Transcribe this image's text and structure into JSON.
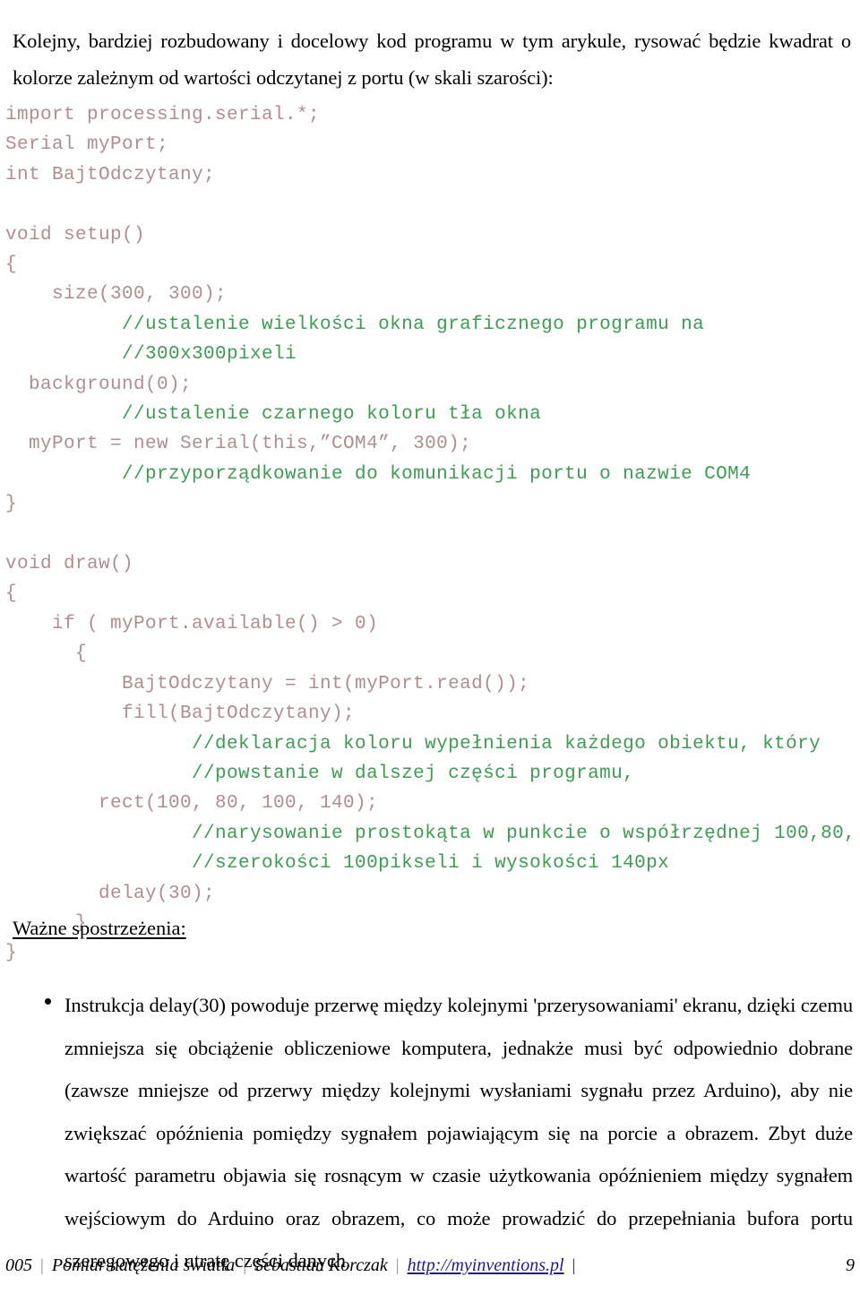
{
  "intro": {
    "paragraph": "Kolejny, bardziej rozbudowany i docelowy kod programu w tym arykule, rysować będzie kwadrat o kolorze zależnym od wartości odczytanej z portu (w skali szarości):"
  },
  "code": {
    "language": "processing",
    "colors": {
      "code": "#b08d90",
      "comment": "#3f9c52"
    },
    "lines": [
      {
        "indent": 0,
        "text": "import processing.serial.*;",
        "kind": "code"
      },
      {
        "indent": 0,
        "text": "Serial myPort;",
        "kind": "code"
      },
      {
        "indent": 0,
        "text": "int BajtOdczytany;",
        "kind": "code"
      },
      {
        "indent": 0,
        "text": "",
        "kind": "blank"
      },
      {
        "indent": 0,
        "text": "void setup()",
        "kind": "code"
      },
      {
        "indent": 0,
        "text": "{",
        "kind": "code"
      },
      {
        "indent": 2,
        "text": "size(300, 300);",
        "kind": "code"
      },
      {
        "indent": 5,
        "text": "//ustalenie wielkości okna graficznego programu na",
        "kind": "comment"
      },
      {
        "indent": 5,
        "text": "//300x300pixeli",
        "kind": "comment"
      },
      {
        "indent": 1,
        "text": "background(0);",
        "kind": "code"
      },
      {
        "indent": 5,
        "text": "//ustalenie czarnego koloru tła okna",
        "kind": "comment"
      },
      {
        "indent": 1,
        "text": "myPort = new Serial(this,”COM4”, 300);",
        "kind": "code"
      },
      {
        "indent": 5,
        "text": "//przyporządkowanie do komunikacji portu o nazwie COM4",
        "kind": "comment"
      },
      {
        "indent": 0,
        "text": "}",
        "kind": "code"
      },
      {
        "indent": 0,
        "text": "",
        "kind": "blank"
      },
      {
        "indent": 0,
        "text": "void draw()",
        "kind": "code"
      },
      {
        "indent": 0,
        "text": "{",
        "kind": "code"
      },
      {
        "indent": 2,
        "text": "if ( myPort.available() > 0)",
        "kind": "code"
      },
      {
        "indent": 3,
        "text": "{",
        "kind": "code"
      },
      {
        "indent": 5,
        "text": "BajtOdczytany = int(myPort.read());",
        "kind": "code"
      },
      {
        "indent": 5,
        "text": "fill(BajtOdczytany);",
        "kind": "code"
      },
      {
        "indent": 8,
        "text": "//deklaracja koloru wypełnienia każdego obiektu, który",
        "kind": "comment"
      },
      {
        "indent": 8,
        "text": "//powstanie w dalszej części programu,",
        "kind": "comment"
      },
      {
        "indent": 4,
        "text": "rect(100, 80, 100, 140);",
        "kind": "code"
      },
      {
        "indent": 8,
        "text": "//narysowanie prostokąta w punkcie o współrzędnej 100,80,",
        "kind": "comment"
      },
      {
        "indent": 8,
        "text": "//szerokości 100pikseli i wysokości 140px",
        "kind": "comment"
      },
      {
        "indent": 4,
        "text": "delay(30);",
        "kind": "code"
      },
      {
        "indent": 3,
        "text": "}",
        "kind": "code"
      },
      {
        "indent": 0,
        "text": "}",
        "kind": "code"
      }
    ]
  },
  "section": {
    "heading": "Ważne spostrzeżenia:"
  },
  "note": {
    "bullet_glyph": "•",
    "text": "Instrukcja delay(30) powoduje przerwę między kolejnymi 'przerysowaniami' ekranu, dzięki czemu zmniejsza się obciążenie obliczeniowe komputera, jednakże musi być odpowiednio dobrane (zawsze mniejsze od przerwy między kolejnymi wysłaniami sygnału przez Arduino), aby nie zwiększać opóźnienia pomiędzy sygnałem pojawiającym się na porcie a obrazem. Zbyt duże wartość parametru objawia się rosnącym w czasie użytkowania opóźnieniem między  sygnałem wejściowym do Arduino oraz obrazem, co może prowadzić do przepełniania bufora portu szeregowego i utratę części danych."
  },
  "footer": {
    "doc_number": "005",
    "title": "Pomiar natężenia światła",
    "author": "Sebastian Korczak",
    "url": "http://myinventions.pl",
    "separator": "|",
    "page_number": "9",
    "url_color": "#1c1c8c"
  }
}
